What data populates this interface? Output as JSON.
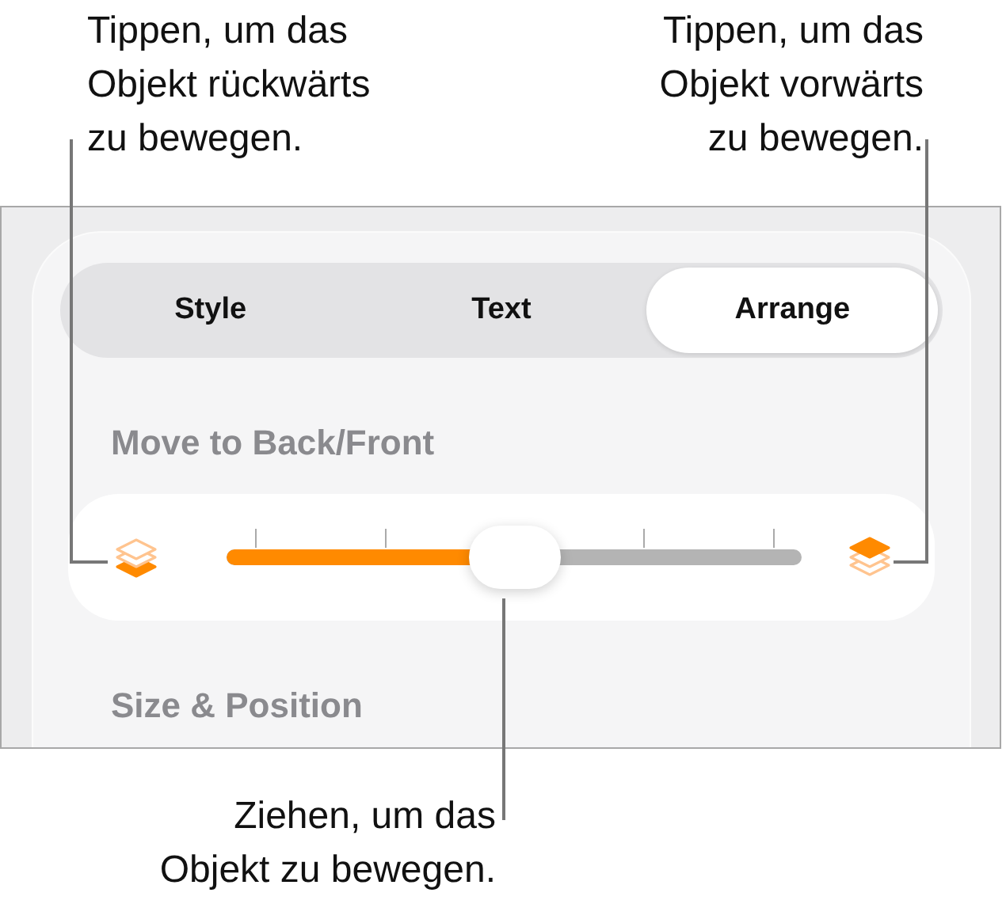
{
  "callout_top_left": "Tippen, um das\nObjekt rückwärts\nzu bewegen.",
  "callout_top_right": "Tippen, um das\nObjekt vorwärts\nzu bewegen.",
  "callout_bottom": "Ziehen, um das\nObjekt zu bewegen.",
  "tabs": [
    {
      "label": "Style",
      "selected": false
    },
    {
      "label": "Text",
      "selected": false
    },
    {
      "label": "Arrange",
      "selected": true
    }
  ],
  "move_section": {
    "title": "Move to Back/Front",
    "slider": {
      "level": 0.5
    }
  },
  "size_section": {
    "title": "Size & Position"
  }
}
